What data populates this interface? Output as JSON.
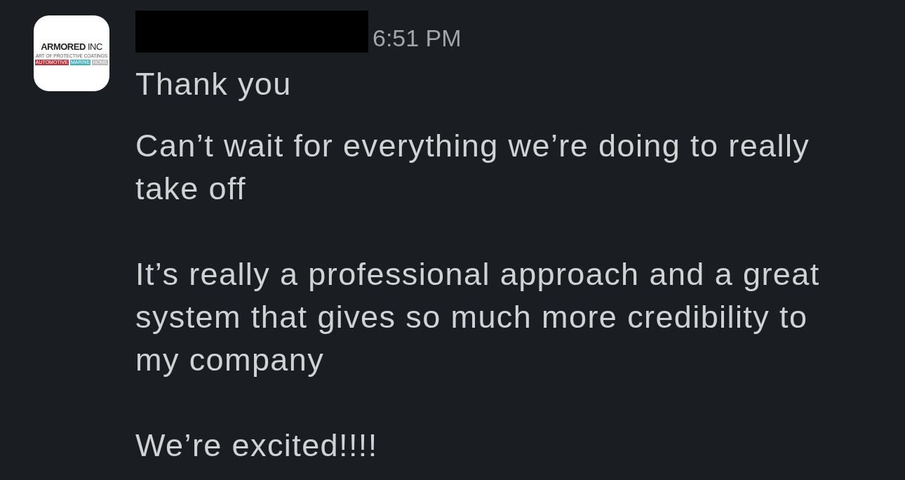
{
  "sender": {
    "avatar": {
      "name": "ARMORED",
      "suffix": "INC",
      "tagline": "ART OF PROTECTIVE COATINGS",
      "tags": [
        {
          "label": "AUTOMOTIVE",
          "color": "#c0323a"
        },
        {
          "label": "MARINE",
          "color": "#3fb3bd"
        },
        {
          "label": "HOME",
          "color": "#b9b9b9"
        }
      ]
    },
    "name_redacted": true
  },
  "time": "6:51 PM",
  "paragraphs": [
    "Thank you",
    "Can’t wait for everything we’re doing to really take off",
    "It’s really a professional approach and a great system that gives so much more credibility to my company",
    "We’re excited!!!!"
  ]
}
